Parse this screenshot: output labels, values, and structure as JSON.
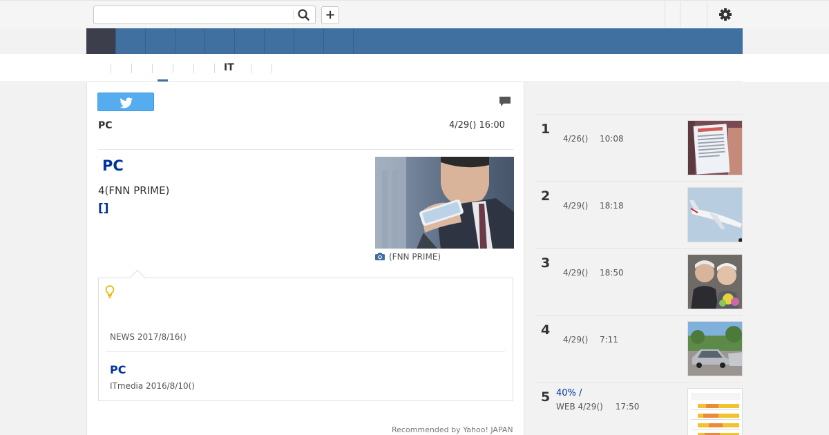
{
  "colors": {
    "nav_background": "#40709f",
    "nav_active": "#3c3f4b",
    "link_blue": "#0033a0",
    "twitter_blue": "#55acee",
    "bulb_yellow": "#f0b400"
  },
  "header": {
    "search": {
      "value": "",
      "placeholder": ""
    },
    "search_icon": "search-icon",
    "add_label": "+",
    "settings_icon": "gear-icon"
  },
  "subtabs": {
    "label": "IT"
  },
  "article": {
    "share_icon": "twitter-icon",
    "comment_icon": "comment-icon",
    "category": "PC",
    "datetime": "4/29() 16:00",
    "headline": "PC",
    "source_line": "4(FNN PRIME)",
    "bracket_link": "[]",
    "photo_caption": "(FNN PRIME)"
  },
  "related": {
    "icon": "lightbulb-icon",
    "item1_source": "NEWS 2017/8/16()",
    "item2_title": "PC",
    "item2_source": "ITmedia  2016/8/10()"
  },
  "recommended": "Recommended by Yahoo! JAPAN",
  "ranking": [
    {
      "rank": "1",
      "date": "4/26()",
      "time": "10:08"
    },
    {
      "rank": "2",
      "date": "4/29()",
      "time": "18:18"
    },
    {
      "rank": "3",
      "date": "4/29()",
      "time": "18:50"
    },
    {
      "rank": "4",
      "date": "4/29()",
      "time": "7:11"
    },
    {
      "rank": "5",
      "title": "40% /",
      "source": "WEB  4/29()",
      "time": "17:50"
    }
  ]
}
